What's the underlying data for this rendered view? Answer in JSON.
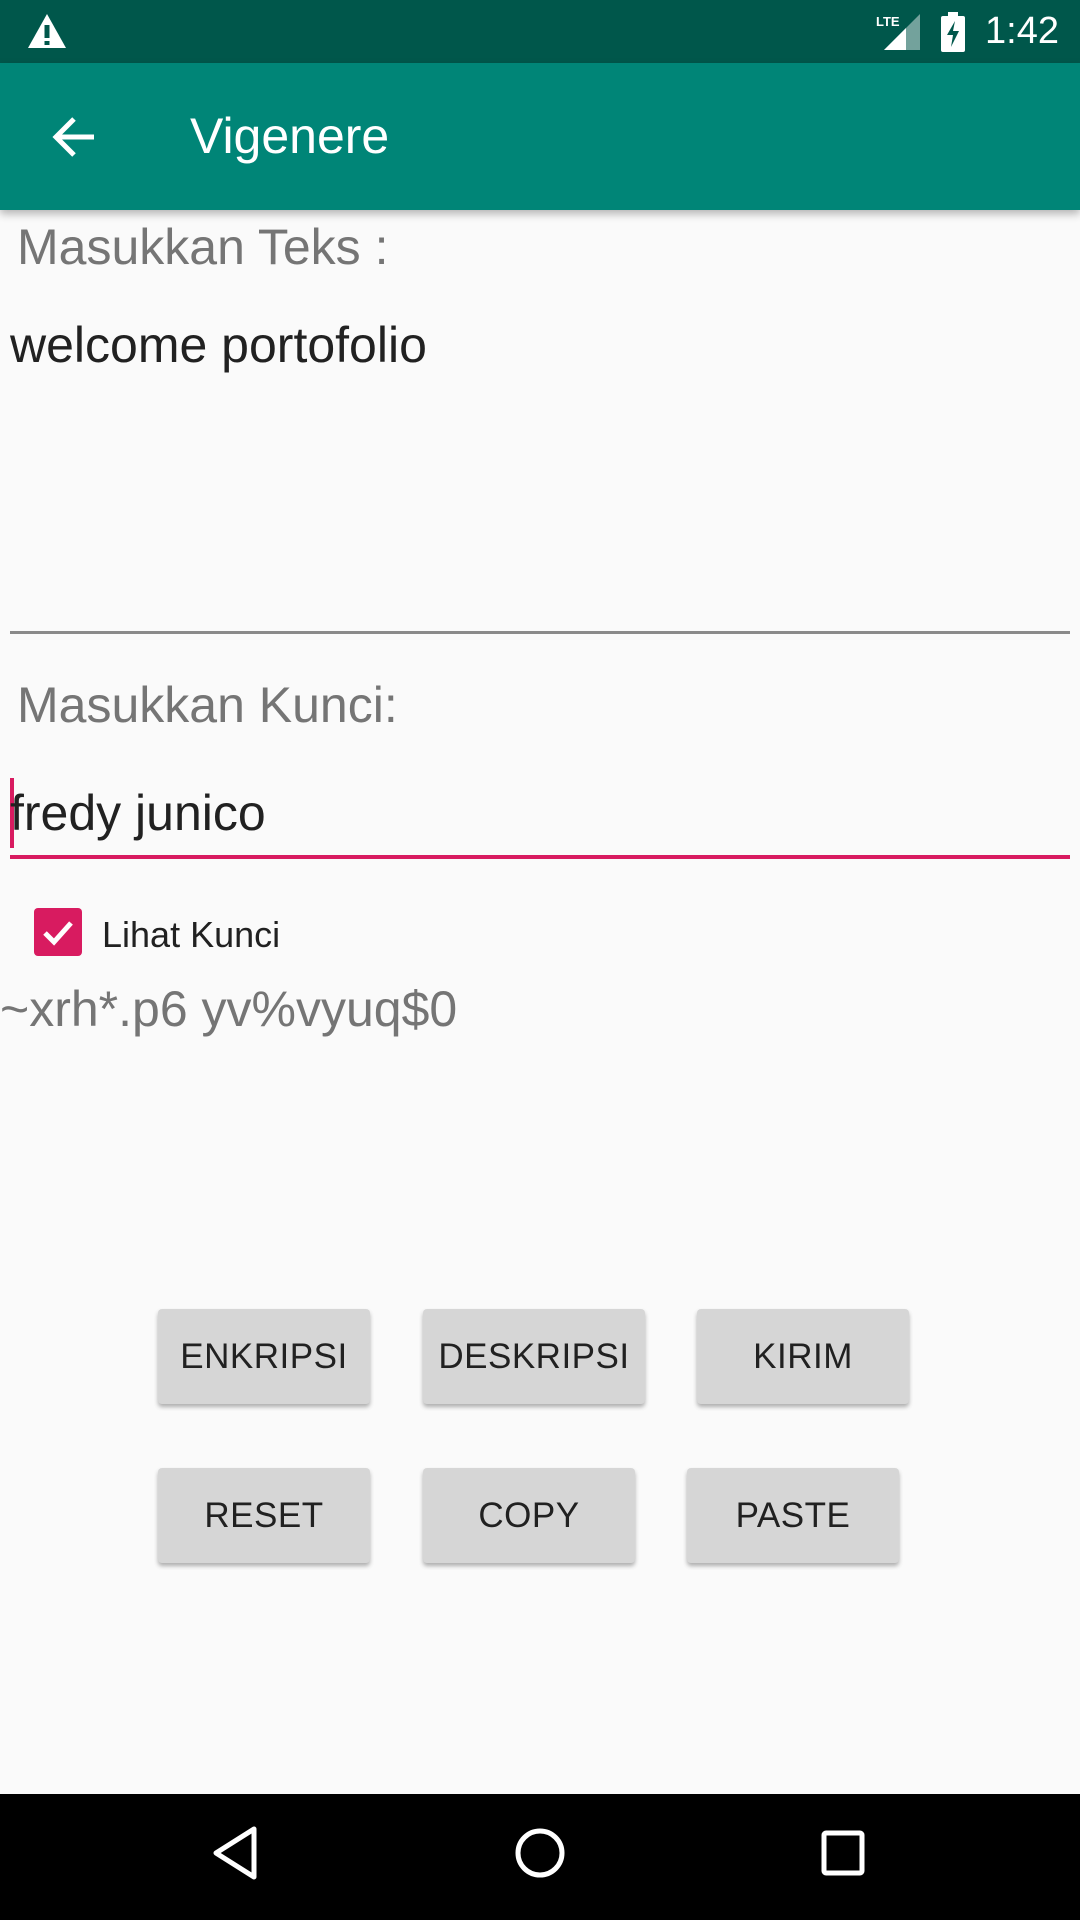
{
  "status_bar": {
    "network": "LTE",
    "time": "1:42"
  },
  "app_bar": {
    "title": "Vigenere",
    "back_icon": "arrow-back-icon"
  },
  "form": {
    "text_label": "Masukkan Teks :",
    "text_value": "welcome portofolio",
    "key_label": "Masukkan Kunci:",
    "key_value": "fredy junico",
    "show_key_label": "Lihat Kunci",
    "show_key_checked": true,
    "output": "~xrh*.p6 yv%vyuq$0"
  },
  "buttons": {
    "encrypt": "ENKRIPSI",
    "decrypt": "DESKRIPSI",
    "send": "KIRIM",
    "reset": "RESET",
    "copy": "COPY",
    "paste": "PASTE"
  },
  "colors": {
    "primary": "#008577",
    "primary_dark": "#00574b",
    "accent": "#d81b60"
  }
}
